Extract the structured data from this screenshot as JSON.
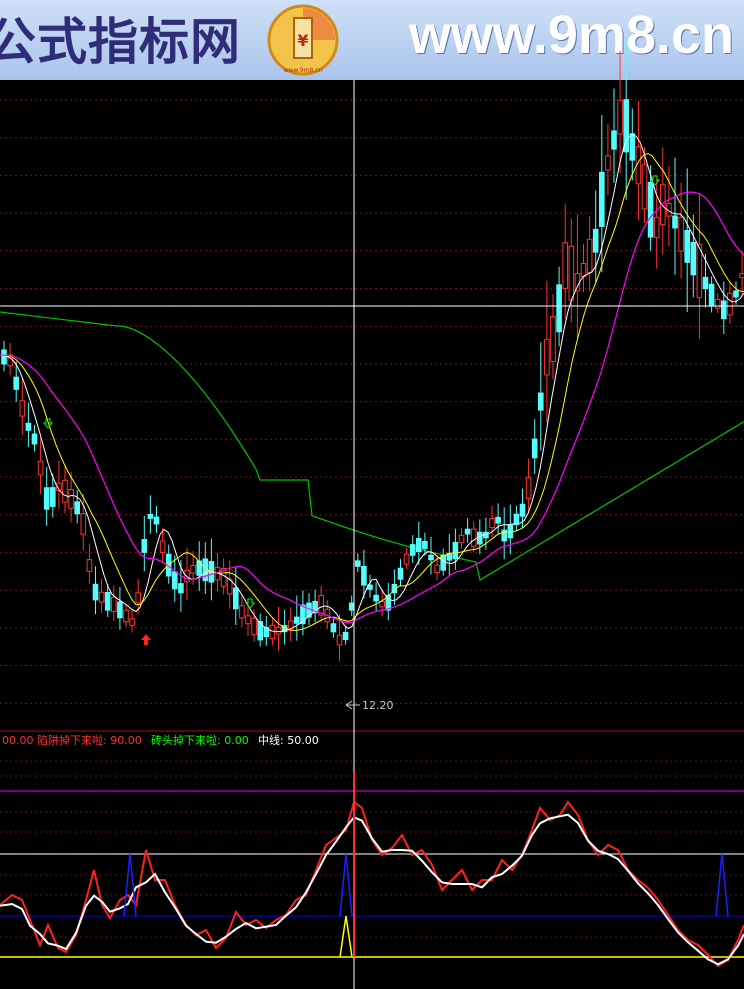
{
  "banner": {
    "title": "公式指标网",
    "url": "www.9m8.cn",
    "logo_small": "www.9m8.cn"
  },
  "chart_data": [
    {
      "type": "candlestick",
      "price_label": "12.20",
      "colors": {
        "up": "#ff3232",
        "down": "#54fcfc",
        "ma5": "#ffffff",
        "ma10": "#ffff00",
        "ma20": "#ff00ff",
        "ma60": "#00c000"
      }
    },
    {
      "type": "line",
      "legend": [
        {
          "label": "00.00",
          "color": "#ff3232"
        },
        {
          "label": "陷阱掉下来啦: 90.00",
          "color": "#ff3232"
        },
        {
          "label": "砖头掉下来啦: 0.00",
          "color": "#00ff00"
        },
        {
          "label": "中线: 50.00",
          "color": "#ffffff"
        }
      ],
      "reference_lines": [
        {
          "name": "upper",
          "color": "#ff00ff"
        },
        {
          "name": "middle",
          "color": "#ffffff"
        },
        {
          "name": "lower",
          "color": "#0000ff"
        }
      ]
    }
  ]
}
